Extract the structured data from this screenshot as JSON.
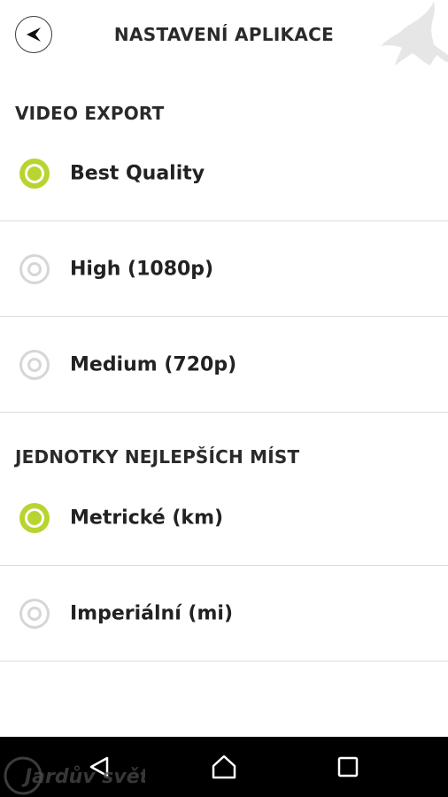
{
  "header": {
    "title": "NASTAVENÍ APLIKACE",
    "back_icon": "back-arrow-icon",
    "logo_icon": "bird-logo-icon"
  },
  "sections": [
    {
      "title": "VIDEO EXPORT",
      "options": [
        {
          "label": "Best Quality",
          "selected": true
        },
        {
          "label": "High (1080p)",
          "selected": false
        },
        {
          "label": "Medium (720p)",
          "selected": false
        }
      ]
    },
    {
      "title": "JEDNOTKY NEJLEPŠÍCH MÍST",
      "options": [
        {
          "label": "Metrické (km)",
          "selected": true
        },
        {
          "label": "Imperiální (mi)",
          "selected": false
        }
      ]
    }
  ],
  "navbar": {
    "back_icon": "nav-back-icon",
    "home_icon": "nav-home-icon",
    "recents_icon": "nav-recents-icon"
  },
  "watermark": {
    "text": "Jardův svět"
  },
  "colors": {
    "accent": "#b8d430",
    "radio_unselected": "#d6d6d6",
    "divider": "#dddddd",
    "navbar": "#000000"
  }
}
